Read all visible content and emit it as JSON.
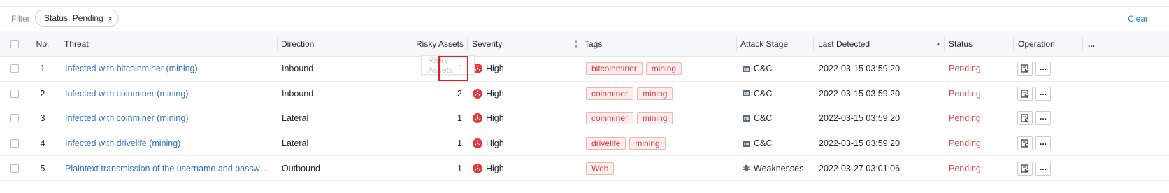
{
  "filter": {
    "label": "Filter:",
    "chip": "Status: Pending",
    "chip_close": "×",
    "clear": "Clear"
  },
  "columns": {
    "no": "No.",
    "threat": "Threat",
    "direction": "Direction",
    "risky_assets": "Risky Assets",
    "severity": "Severity",
    "tags": "Tags",
    "attack_stage": "Attack Stage",
    "last_detected": "Last Detected",
    "status": "Status",
    "operation": "Operation",
    "more": "..."
  },
  "tooltip": "Risky Assets",
  "rows": [
    {
      "no": "1",
      "threat": "Infected with bitcoinminer (mining)",
      "direction": "Inbound",
      "risky_assets": "7",
      "severity": "High",
      "tags": [
        "bitcoinminer",
        "mining"
      ],
      "stage": "C&C",
      "stage_icon": "cnc-icon",
      "last_detected": "2022-03-15 03:59:20",
      "status": "Pending"
    },
    {
      "no": "2",
      "threat": "Infected with coinminer (mining)",
      "direction": "Inbound",
      "risky_assets": "2",
      "severity": "High",
      "tags": [
        "coinminer",
        "mining"
      ],
      "stage": "C&C",
      "stage_icon": "cnc-icon",
      "last_detected": "2022-03-15 03:59:20",
      "status": "Pending"
    },
    {
      "no": "3",
      "threat": "Infected with coinminer (mining)",
      "direction": "Lateral",
      "risky_assets": "1",
      "severity": "High",
      "tags": [
        "coinminer",
        "mining"
      ],
      "stage": "C&C",
      "stage_icon": "cnc-icon",
      "last_detected": "2022-03-15 03:59:20",
      "status": "Pending"
    },
    {
      "no": "4",
      "threat": "Infected with drivelife (mining)",
      "direction": "Lateral",
      "risky_assets": "1",
      "severity": "High",
      "tags": [
        "drivelife",
        "mining"
      ],
      "stage": "C&C",
      "stage_icon": "cnc-icon",
      "last_detected": "2022-03-15 03:59:20",
      "status": "Pending"
    },
    {
      "no": "5",
      "threat": "Plaintext transmission of the username and password for...",
      "direction": "Outbound",
      "risky_assets": "1",
      "severity": "High",
      "tags": [
        "Web"
      ],
      "stage": "Weaknesses",
      "stage_icon": "bug-icon",
      "last_detected": "2022-03-27 03:01:06",
      "status": "Pending"
    }
  ],
  "colors": {
    "accent": "#2d6fc4",
    "severity_high": "#e4393c",
    "tag_text": "#d9363e",
    "tag_bg": "#fdeeee",
    "status_pending": "#e04a48",
    "highlight": "#e02020"
  }
}
